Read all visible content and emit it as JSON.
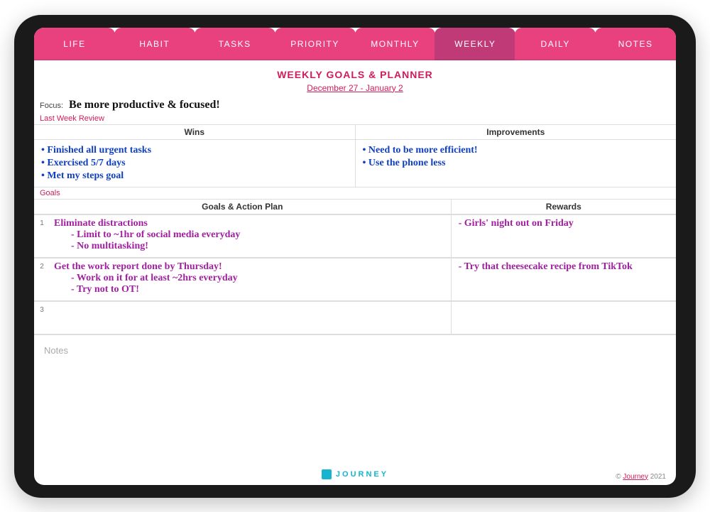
{
  "tabs": [
    {
      "label": "LIFE",
      "active": false
    },
    {
      "label": "HABIT",
      "active": false
    },
    {
      "label": "TASKS",
      "active": false
    },
    {
      "label": "PRIORITY",
      "active": false
    },
    {
      "label": "MONTHLY",
      "active": false
    },
    {
      "label": "WEEKLY",
      "active": true
    },
    {
      "label": "DAILY",
      "active": false
    },
    {
      "label": "NOTES",
      "active": false
    }
  ],
  "header": {
    "title": "WEEKLY GOALS & PLANNER",
    "date_range": "December 27 - January 2"
  },
  "focus": {
    "label": "Focus:",
    "value": "Be more productive & focused!"
  },
  "review": {
    "section_label": "Last Week Review",
    "wins_header": "Wins",
    "improvements_header": "Improvements",
    "wins": [
      "• Finished all urgent tasks",
      "• Exercised 5/7 days",
      "• Met my steps goal"
    ],
    "improvements": [
      "• Need to be more efficient!",
      "• Use the phone less"
    ]
  },
  "goals": {
    "section_label": "Goals",
    "plan_header": "Goals & Action Plan",
    "rewards_header": "Rewards",
    "rows": [
      {
        "num": "1",
        "title": "Eliminate distractions",
        "sub1": "- Limit to ~1hr of social media everyday",
        "sub2": "- No multitasking!",
        "reward": "- Girls' night out on Friday"
      },
      {
        "num": "2",
        "title": "Get the work report done by Thursday!",
        "sub1": "- Work on it for at least ~2hrs everyday",
        "sub2": "- Try not to OT!",
        "reward": "- Try that cheesecake recipe from TikTok"
      },
      {
        "num": "3",
        "title": "",
        "sub1": "",
        "sub2": "",
        "reward": ""
      }
    ]
  },
  "notes": {
    "label": "Notes"
  },
  "footer": {
    "brand": "JOURNEY",
    "copyright_prefix": "© ",
    "copyright_brand": "Journey",
    "copyright_year": " 2021"
  }
}
